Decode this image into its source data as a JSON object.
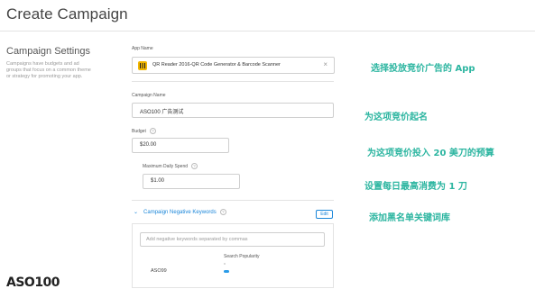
{
  "page": {
    "title": "Create Campaign"
  },
  "settings": {
    "title": "Campaign Settings",
    "description": "Campaigns have budgets and ad groups that focus on a common theme or strategy for promoting your app."
  },
  "app": {
    "label": "App Name",
    "name": "QR Reader 2016-QR Code Generator & Barcode Scanner",
    "clear_icon": "close-icon"
  },
  "campaign": {
    "label": "Campaign Name",
    "value": "ASO100 广告测试"
  },
  "budget": {
    "label": "Budget",
    "value": "$20.00",
    "help_icon": "?"
  },
  "daily": {
    "label": "Maximum Daily Spend",
    "value": "$1.00",
    "help_icon": "?"
  },
  "negative_keywords": {
    "title": "Campaign Negative Keywords",
    "help_icon": "?",
    "edit_label": "Edit",
    "placeholder": "Add negative keywords separated by commas",
    "column_header": "Search Popularity",
    "rows": [
      {
        "keyword": "ASO99",
        "popularity": 0.2
      }
    ]
  },
  "annotations": [
    "选择投放竞价广告的 App",
    "为这项竞价起名",
    "为这项竞价投入 20 美刀的预算",
    "设置每日最高消费为 1 刀",
    "添加黑名单关键词库"
  ],
  "brand": {
    "logo_text": "ASO100"
  },
  "colors": {
    "accent": "#1a86d9",
    "annotation": "#2bb5a0",
    "app_icon": "#f2b600"
  }
}
